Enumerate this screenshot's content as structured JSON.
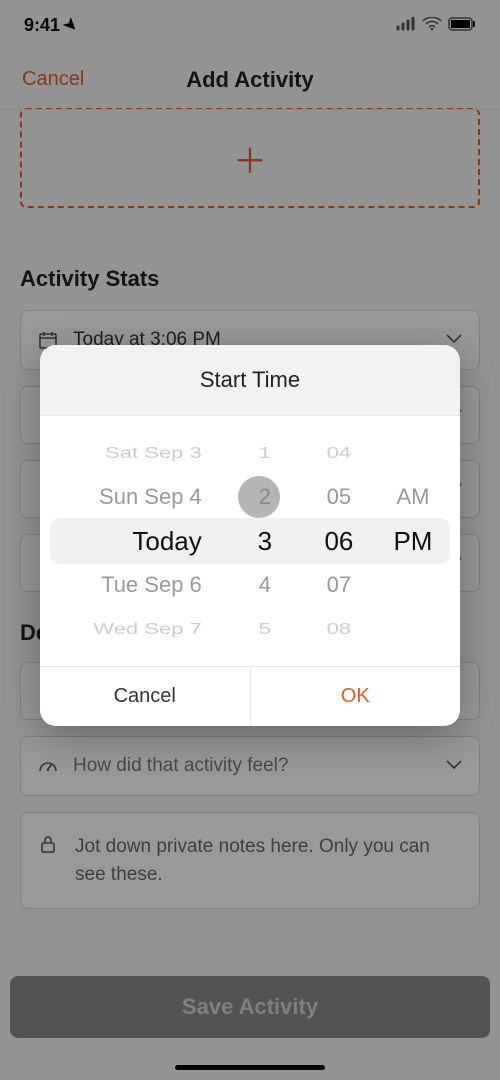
{
  "status": {
    "time": "9:41"
  },
  "nav": {
    "cancel": "Cancel",
    "title": "Add Activity"
  },
  "stats": {
    "heading": "Activity Stats",
    "date_field": "Today at 3:06 PM"
  },
  "desc": {
    "heading_clip": "De",
    "feel_prompt": "How did that activity feel?",
    "notes_placeholder": "Jot down private notes here. Only you can see these."
  },
  "save_label": "Save Activity",
  "modal": {
    "title": "Start Time",
    "cancel": "Cancel",
    "ok": "OK",
    "date_wheel": [
      "Sat Sep 3",
      "Sun Sep 4",
      "Today",
      "Tue Sep 6",
      "Wed Sep 7"
    ],
    "hour_wheel": [
      "1",
      "2",
      "3",
      "4",
      "5"
    ],
    "minute_wheel": [
      "04",
      "05",
      "06",
      "07",
      "08"
    ],
    "ampm_wheel": [
      "",
      "AM",
      "PM",
      "",
      ""
    ]
  }
}
